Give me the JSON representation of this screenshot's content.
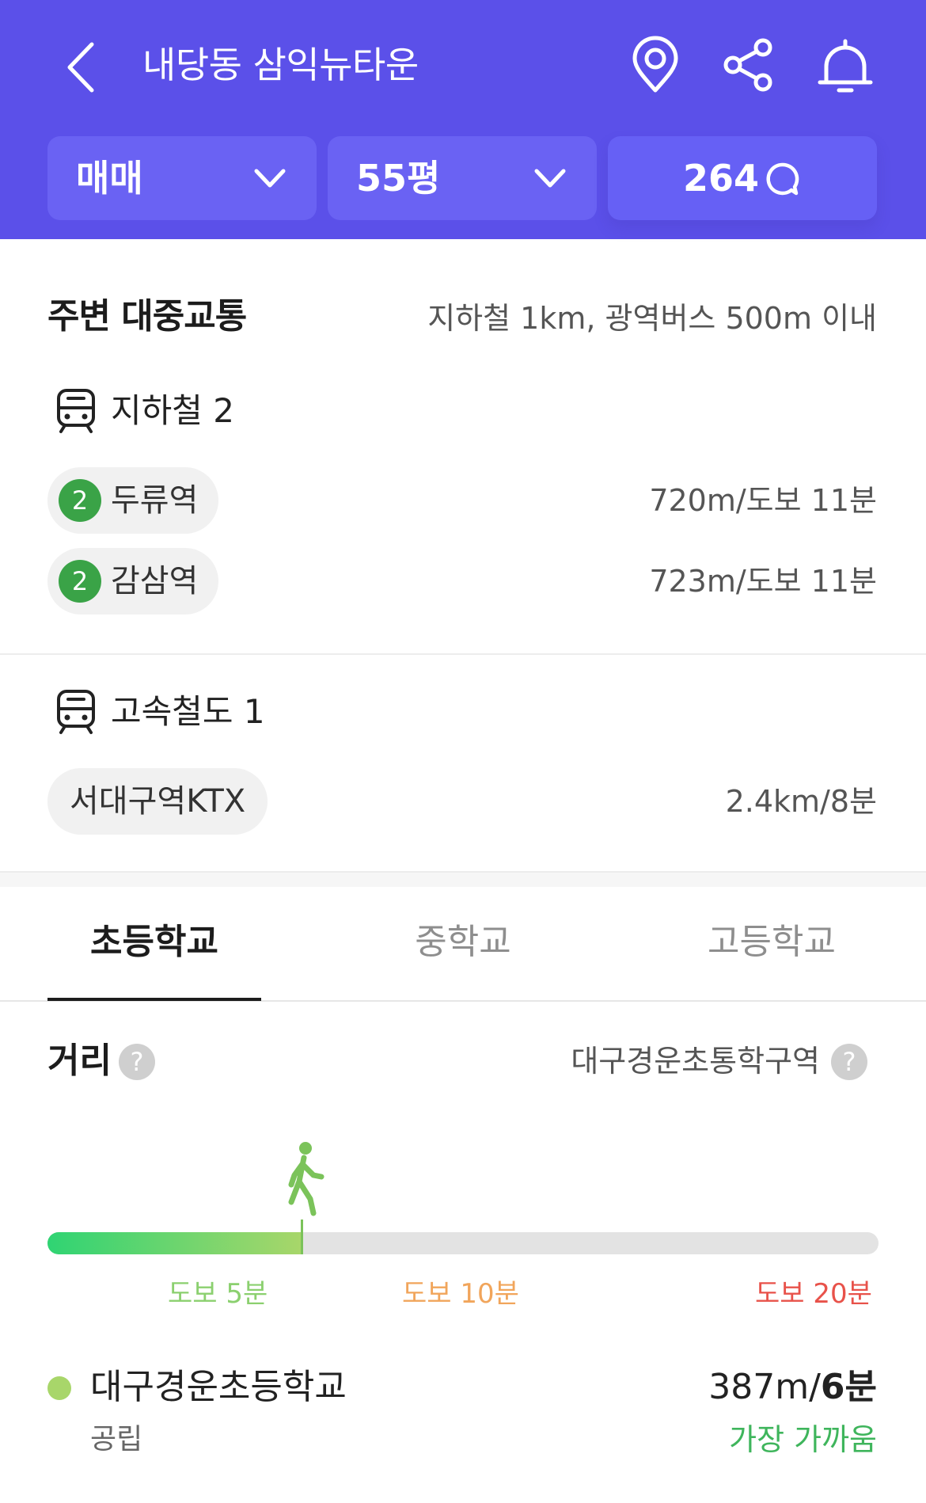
{
  "header": {
    "title": "내당동 삼익뉴타운",
    "back_icon": "back-chevron-icon",
    "icons": [
      "location-pin-icon",
      "share-icon",
      "bell-icon"
    ],
    "bg_color": "#5b50e9"
  },
  "filters": {
    "deal_type": "매매",
    "area": "55평",
    "talk_count": "264"
  },
  "transit": {
    "title": "주변 대중교통",
    "description": "지하철 1km, 광역버스 500m 이내",
    "subway": {
      "label": "지하철 2",
      "stations": [
        {
          "line": "2",
          "name": "두류역",
          "distance": "720m/도보 11분"
        },
        {
          "line": "2",
          "name": "감삼역",
          "distance": "723m/도보 11분"
        }
      ]
    },
    "express": {
      "label": "고속철도 1",
      "stations": [
        {
          "name": "서대구역KTX",
          "distance": "2.4km/8분"
        }
      ]
    }
  },
  "tabs": [
    "초등학교",
    "중학교",
    "고등학교"
  ],
  "active_tab": 0,
  "distance": {
    "title": "거리",
    "zone": "대구경운초통학구역",
    "progress": 0.306,
    "scale": [
      "도보 5분",
      "도보 10분",
      "도보 20분"
    ],
    "scale_colors": [
      "#8bd06f",
      "#f1a55b",
      "#e8524a"
    ]
  },
  "school": {
    "name": "대구경운초등학교",
    "type": "공립",
    "distance": "387m/",
    "time": "6분",
    "tag": "가장 가까움",
    "dot_color": "#a8d66a"
  }
}
